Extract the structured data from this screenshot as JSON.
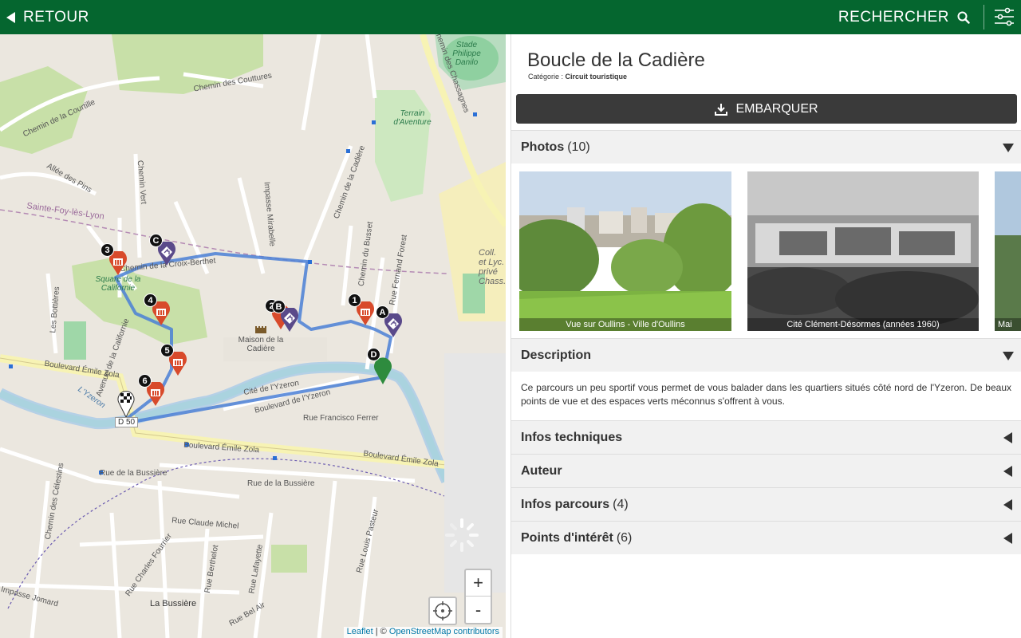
{
  "topbar": {
    "back_label": "RETOUR",
    "search_label": "RECHERCHER",
    "bg_color": "#05662f"
  },
  "map": {
    "labels": {
      "street_courtille": "Chemin de la Courtille",
      "street_couttures": "Chemin des Couttures",
      "street_pins": "Allée des Pins",
      "street_sainte_foy": "Sainte-Foy-lès-Lyon",
      "street_croix": "Chemin de la Croix-Berthet",
      "street_bottieres": "Les Bottières",
      "street_vert": "Chemin Vert",
      "street_mirabelle": "Impasse Mirabelle",
      "street_cadiere": "Chemin de la Cadière",
      "street_busset": "Chemin du Busset",
      "street_forest": "Rue Fernand Forest",
      "street_zola": "Boulevard Émile Zola",
      "street_zola2": "Boulevard Émile Zola",
      "street_zola3": "Boulevard Émile Zola",
      "street_californie": "Avenue de la Californie",
      "street_yzeron_cite": "Cité de l'Yzeron",
      "street_yzeron_bd": "Boulevard de l'Yzeron",
      "street_ferrer": "Rue Francisco Ferrer",
      "street_bussiere": "Rue de la Bussière",
      "street_bussiere2": "Rue de la Bussière",
      "street_celestins": "Chemin des Célestins",
      "street_michel": "Rue Claude Michel",
      "street_pasteur": "Rue Louis Pasteur",
      "street_fourrier": "Rue Charles Fourrier",
      "street_berthelot": "Rue Berthelot",
      "street_lafayette": "Rue Lafayette",
      "street_belair": "Rue Bel Air",
      "street_jomard": "Impasse Jomard",
      "place_bussiere": "La Bussière",
      "stade": "Stade Philippe Danilo",
      "terrain": "Terrain d'Aventure",
      "californie": "Square de la Californie",
      "maison": "Maison de la Cadière",
      "road_d50": "D 50",
      "yzeron": "L'Yzeron",
      "chassagnes": "Chemin des Chassagnes",
      "college": "Coll. et Lyc. privé Chass."
    },
    "markers_numbered": [
      "1",
      "2",
      "3",
      "4",
      "5",
      "6"
    ],
    "markers_lettered": [
      "A",
      "B",
      "C",
      "D"
    ],
    "zoom_in": "+",
    "zoom_out": "-",
    "attribution_leaflet": "Leaflet",
    "attribution_sep": " | © ",
    "attribution_osm": "OpenStreetMap contributors",
    "route_color": "#4a7fd6",
    "poi_color": "#d84a2b",
    "step_color": "#5a4a8a"
  },
  "detail": {
    "title": "Boucle de la Cadière",
    "category_label": "Catégorie :",
    "category_value": "Circuit touristique",
    "embark_label": "EMBARQUER",
    "photos_label": "Photos",
    "photos_count": "(10)",
    "photos": [
      {
        "caption": "Vue sur Oullins - Ville d'Oullins"
      },
      {
        "caption": "Cité Clément-Désormes (années 1960)"
      },
      {
        "caption": "Mai"
      }
    ],
    "description_label": "Description",
    "description_text": "Ce parcours un peu sportif vous permet de vous balader dans les quartiers situés côté nord de l'Yzeron. De beaux points de vue et des espaces verts méconnus s'offrent à vous.",
    "infos_tech_label": "Infos techniques",
    "author_label": "Auteur",
    "infos_parcours_label": "Infos parcours",
    "infos_parcours_count": "(4)",
    "poi_label": "Points d'intérêt",
    "poi_count": "(6)"
  }
}
